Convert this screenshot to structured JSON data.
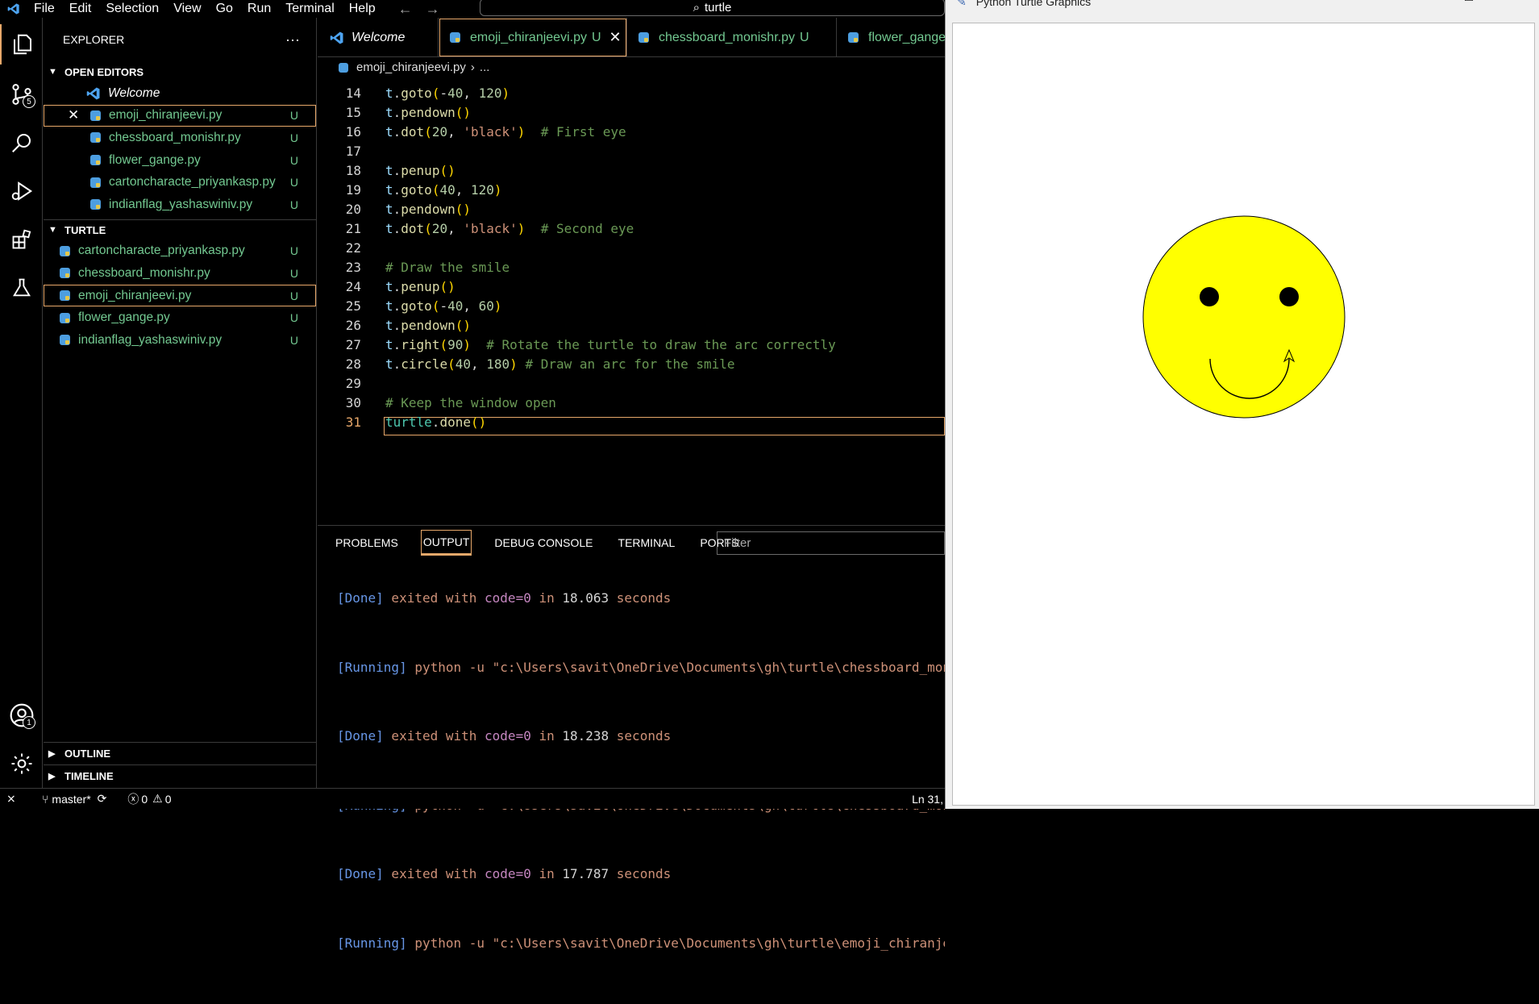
{
  "menu": {
    "items": [
      "File",
      "Edit",
      "Selection",
      "View",
      "Go",
      "Run",
      "Terminal",
      "Help"
    ],
    "search": "turtle"
  },
  "activity": {
    "source_control_badge": "5",
    "accounts_badge": "1"
  },
  "explorer": {
    "title": "EXPLORER",
    "more": "···",
    "open_editors_label": "OPEN EDITORS",
    "turtle_label": "TURTLE",
    "outline_label": "OUTLINE",
    "timeline_label": "TIMELINE",
    "open_editors": [
      {
        "name": "Welcome"
      },
      {
        "name": "emoji_chiranjeevi.py",
        "status": "U"
      },
      {
        "name": "chessboard_monishr.py",
        "status": "U"
      },
      {
        "name": "flower_gange.py",
        "status": "U"
      },
      {
        "name": "cartoncharacte_priyankasp.py",
        "status": "U"
      },
      {
        "name": "indianflag_yashaswiniv.py",
        "status": "U"
      }
    ],
    "turtle_files": [
      {
        "name": "cartoncharacte_priyankasp.py",
        "status": "U"
      },
      {
        "name": "chessboard_monishr.py",
        "status": "U"
      },
      {
        "name": "emoji_chiranjeevi.py",
        "status": "U"
      },
      {
        "name": "flower_gange.py",
        "status": "U"
      },
      {
        "name": "indianflag_yashaswiniv.py",
        "status": "U"
      }
    ]
  },
  "tabs": [
    {
      "label": "Welcome"
    },
    {
      "label": "emoji_chiranjeevi.py",
      "status": "U"
    },
    {
      "label": "chessboard_monishr.py",
      "status": "U"
    },
    {
      "label": "flower_gange"
    }
  ],
  "breadcrumb": {
    "file": "emoji_chiranjeevi.py",
    "rest": "..."
  },
  "code": {
    "line_numbers": [
      "14",
      "15",
      "16",
      "17",
      "18",
      "19",
      "20",
      "21",
      "22",
      "23",
      "24",
      "25",
      "26",
      "27",
      "28",
      "29",
      "30",
      "31"
    ],
    "current_line": "31"
  },
  "panel": {
    "tabs": [
      "PROBLEMS",
      "OUTPUT",
      "DEBUG CONSOLE",
      "TERMINAL",
      "PORTS"
    ],
    "filter_placeholder": "Filter",
    "output": [
      {
        "tag": "[Done]",
        "text": " exited with ",
        "key": "code=0",
        "mid": " in ",
        "num": "18.063",
        "end": " seconds"
      },
      {
        "tag": "[Running]",
        "cmd": " python -u \"c:\\Users\\savit\\OneDrive\\Documents\\gh\\turtle\\chessboard_mon"
      },
      {
        "tag": "[Done]",
        "text": " exited with ",
        "key": "code=0",
        "mid": " in ",
        "num": "18.238",
        "end": " seconds"
      },
      {
        "tag": "[Running]",
        "cmd": " python -u \"c:\\Users\\savit\\OneDrive\\Documents\\gh\\turtle\\chessboard_mon"
      },
      {
        "tag": "[Done]",
        "text": " exited with ",
        "key": "code=0",
        "mid": " in ",
        "num": "17.787",
        "end": " seconds"
      },
      {
        "tag": "[Running]",
        "cmd": " python -u \"c:\\Users\\savit\\OneDrive\\Documents\\gh\\turtle\\emoji_chiranje"
      }
    ]
  },
  "status": {
    "branch": "master*",
    "errors": "0",
    "warnings": "0",
    "position": "Ln 31,"
  },
  "turtle_window": {
    "title": "Python Turtle Graphics",
    "face_color": "#ffff00"
  }
}
